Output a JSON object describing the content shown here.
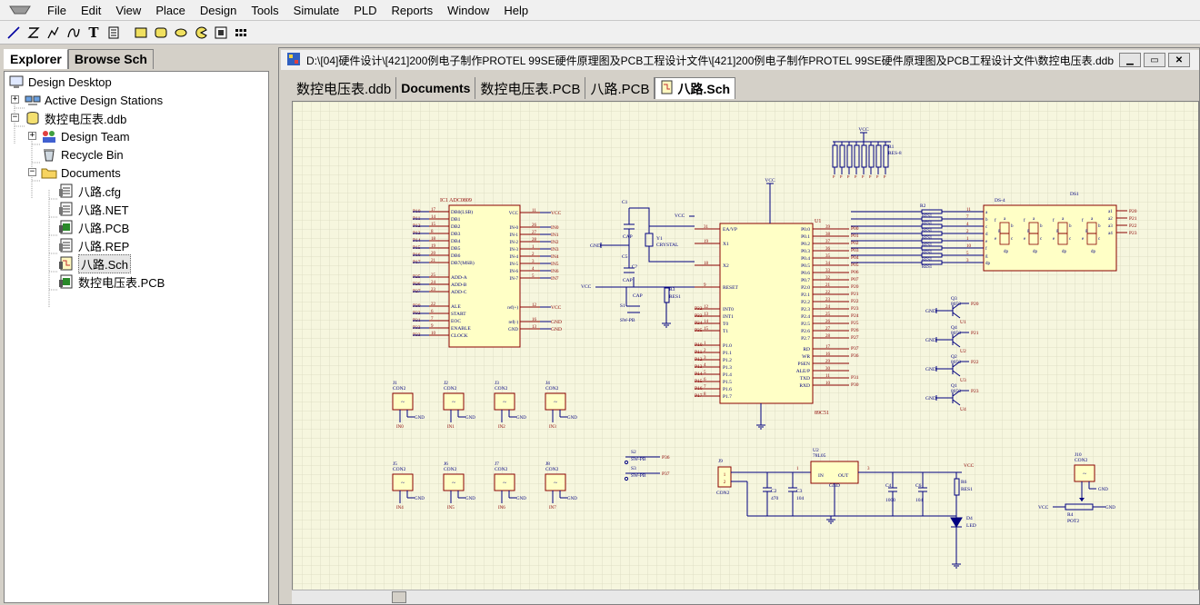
{
  "menu": {
    "items": [
      "File",
      "Edit",
      "View",
      "Place",
      "Design",
      "Tools",
      "Simulate",
      "PLD",
      "Reports",
      "Window",
      "Help"
    ]
  },
  "toolbar": {
    "tools": [
      "line-icon",
      "bus-icon",
      "pen-icon",
      "bezier-icon",
      "text-icon",
      "text-frame-icon",
      "rectangle-icon",
      "rounded-rectangle-icon",
      "ellipse-icon",
      "pie-icon",
      "graphic-icon",
      "array-icon"
    ]
  },
  "explorer": {
    "tabs": [
      "Explorer",
      "Browse Sch"
    ],
    "tree": {
      "root": "Design Desktop",
      "active_stations": "Active Design Stations",
      "ddb": "数控电压表.ddb",
      "design_team": "Design Team",
      "recycle_bin": "Recycle Bin",
      "documents": "Documents",
      "files": [
        "八路.cfg",
        "八路.NET",
        "八路.PCB",
        "八路.REP",
        "八路.Sch",
        "数控电压表.PCB"
      ],
      "selected": "八路.Sch"
    }
  },
  "document": {
    "title": "D:\\[04]硬件设计\\[421]200例电子制作PROTEL 99SE硬件原理图及PCB工程设计文件\\[421]200例电子制作PROTEL 99SE硬件原理图及PCB工程设计文件\\数控电压表.ddb",
    "tabs": [
      "数控电压表.ddb",
      "Documents",
      "数控电压表.PCB",
      "八路.PCB",
      "八路.Sch"
    ],
    "active_tab": "八路.Sch"
  },
  "schematic": {
    "colors": {
      "sheet": "#f6f6de",
      "grid": "#d9d9bf",
      "wire": "#000080",
      "body": "#ffffc6",
      "outline": "#8b0000",
      "pin": "#8b0000",
      "label": "#000080"
    },
    "adc": {
      "ref": "IC1",
      "part": "ADC0809",
      "left_pins": [
        [
          "17",
          "DB0(LSB)"
        ],
        [
          "14",
          "DB1"
        ],
        [
          "15",
          "DB2"
        ],
        [
          "8",
          "DB3"
        ],
        [
          "18",
          "DB4"
        ],
        [
          "19",
          "DB5"
        ],
        [
          "20",
          "DB6"
        ],
        [
          "21",
          "DB7(MSB)"
        ],
        [
          "",
          ""
        ],
        [
          "25",
          "ADD-A"
        ],
        [
          "24",
          "ADD-B"
        ],
        [
          "23",
          "ADD-C"
        ],
        [
          "",
          ""
        ],
        [
          "22",
          "ALE"
        ],
        [
          "6",
          "START"
        ],
        [
          "7",
          "EOC"
        ],
        [
          "9",
          "ENABLE"
        ],
        [
          "10",
          "CLOCK"
        ]
      ],
      "left_nets": [
        "P10",
        "P11",
        "P12",
        "P13",
        "P14",
        "P15",
        "P16",
        "P17",
        "",
        "P25",
        "P26",
        "P27",
        "",
        "P30",
        "P32",
        "P31",
        "P33",
        "P33"
      ],
      "right_pins": [
        [
          "11",
          "VCC"
        ],
        [
          "",
          ""
        ],
        [
          "26",
          "IN-0"
        ],
        [
          "27",
          "IN-1"
        ],
        [
          "28",
          "IN-2"
        ],
        [
          "1",
          "IN-3"
        ],
        [
          "2",
          "IN-4"
        ],
        [
          "3",
          "IN-5"
        ],
        [
          "4",
          "IN-6"
        ],
        [
          "5",
          "IN-7"
        ],
        [
          "",
          ""
        ],
        [
          "",
          ""
        ],
        [
          "",
          ""
        ],
        [
          "12",
          "ref(+)"
        ],
        [
          "",
          ""
        ],
        [
          "16",
          "ref(-)"
        ],
        [
          "13",
          "GND"
        ]
      ],
      "right_nets": [
        "VCC",
        "",
        "IN0",
        "IN1",
        "IN2",
        "IN3",
        "IN4",
        "IN5",
        "IN6",
        "IN7",
        "",
        "",
        "",
        "VCC",
        "",
        "GND",
        "GND"
      ]
    },
    "mcu": {
      "ref": "U1",
      "part": "89C51",
      "left_pins": [
        [
          "31",
          "EA/VP"
        ],
        [
          "19",
          "X1"
        ],
        [
          "18",
          "X2"
        ],
        [
          "9",
          "RESET"
        ],
        [
          "12",
          "INT0"
        ],
        [
          "13",
          "INT1"
        ],
        [
          "14",
          "T0"
        ],
        [
          "15",
          "T1"
        ],
        [
          "1",
          "P1.0"
        ],
        [
          "2",
          "P1.1"
        ],
        [
          "3",
          "P1.2"
        ],
        [
          "4",
          "P1.3"
        ],
        [
          "5",
          "P1.4"
        ],
        [
          "6",
          "P1.5"
        ],
        [
          "7",
          "P1.6"
        ],
        [
          "8",
          "P1.7"
        ]
      ],
      "right_pins": [
        [
          "39",
          "P0.0"
        ],
        [
          "38",
          "P0.1"
        ],
        [
          "37",
          "P0.2"
        ],
        [
          "36",
          "P0.3"
        ],
        [
          "35",
          "P0.4"
        ],
        [
          "34",
          "P0.5"
        ],
        [
          "33",
          "P0.6"
        ],
        [
          "32",
          "P0.7"
        ],
        [
          "21",
          "P2.0"
        ],
        [
          "22",
          "P2.1"
        ],
        [
          "23",
          "P2.2"
        ],
        [
          "24",
          "P2.3"
        ],
        [
          "25",
          "P2.4"
        ],
        [
          "26",
          "P2.5"
        ],
        [
          "27",
          "P2.6"
        ],
        [
          "28",
          "P2.7"
        ],
        [
          "17",
          "RD"
        ],
        [
          "16",
          "WR"
        ],
        [
          "29",
          "PSEN"
        ],
        [
          "30",
          "ALE/P"
        ],
        [
          "11",
          "TXD"
        ],
        [
          "10",
          "RXD"
        ]
      ],
      "right_nets": [
        "P00",
        "P01",
        "P02",
        "P03",
        "P04",
        "P05",
        "P06",
        "P07",
        "P20",
        "P21",
        "P22",
        "P23",
        "P24",
        "P25",
        "P26",
        "P27",
        "P37",
        "P36",
        "",
        "",
        "P31",
        "P30"
      ],
      "left_nets": [
        "",
        "",
        "",
        "",
        "P32",
        "P33",
        "P34",
        "P35",
        "P10",
        "P11",
        "P12",
        "P13",
        "P14",
        "P15",
        "P16",
        "P17"
      ]
    },
    "display": {
      "ref": "DS1",
      "part": "DS-4",
      "segments": [
        "a",
        "b",
        "c",
        "d",
        "e",
        "f",
        "g",
        "dp"
      ],
      "commons": [
        "a1",
        "a2",
        "a3",
        "a4"
      ],
      "nets": [
        "P20",
        "P21",
        "P22",
        "P23"
      ]
    },
    "resistor_array": {
      "ref": "R1",
      "part": "RES-8",
      "net": "VCC"
    },
    "segment_resistors": {
      "ref": "R2",
      "part": "RES1",
      "pins": [
        "11",
        "7",
        "4",
        "2",
        "1",
        "10",
        "5",
        "3"
      ]
    },
    "transistors": [
      {
        "ref": "Q3",
        "part": "8050",
        "net": "P20",
        "base": "U1"
      },
      {
        "ref": "Q4",
        "part": "8050",
        "net": "P21",
        "base": "U2"
      },
      {
        "ref": "Q2",
        "part": "8050",
        "net": "P22",
        "base": "U3"
      },
      {
        "ref": "Q1",
        "part": "8050",
        "net": "P23",
        "base": "U4"
      }
    ],
    "osc": {
      "c1": "C1",
      "c1_val": "CAP",
      "c2": "C5",
      "c2_val": "CAP",
      "xtal": "Y1",
      "xtal_val": "CRYSTAL",
      "c3": "C?",
      "c3_val": "CAP",
      "reset_sw": "S1",
      "reset_sw_val": "SW-PB",
      "reset_r": "R3",
      "reset_r_val": "RES1"
    },
    "connectors_top": [
      {
        "ref": "J1",
        "part": "CON2",
        "net": "IN0"
      },
      {
        "ref": "J2",
        "part": "CON2",
        "net": "IN1"
      },
      {
        "ref": "J3",
        "part": "CON2",
        "net": "IN2"
      },
      {
        "ref": "J4",
        "part": "CON2",
        "net": "IN3"
      }
    ],
    "connectors_bottom": [
      {
        "ref": "J5",
        "part": "CON2",
        "net": "IN4"
      },
      {
        "ref": "J6",
        "part": "CON2",
        "net": "IN5"
      },
      {
        "ref": "J7",
        "part": "CON2",
        "net": "IN6"
      },
      {
        "ref": "J8",
        "part": "CON2",
        "net": "IN7"
      }
    ],
    "buttons": [
      {
        "ref": "S2",
        "part": "SW-PB",
        "net": "P36"
      },
      {
        "ref": "S3",
        "part": "SW-PB",
        "net": "P37"
      }
    ],
    "power": {
      "j9": "J9",
      "j9_part": "CON2",
      "c2": "C2",
      "c2_val": "470",
      "c3": "C3",
      "c3_val": "104",
      "reg": "U2",
      "reg_part": "78L05",
      "reg_in": "IN",
      "reg_out": "OUT",
      "reg_gnd": "GND",
      "c4": "C4",
      "c4_val": "1000",
      "c6": "C6",
      "c6_val": "104",
      "r6": "R6",
      "r6_val": "RES1",
      "led": "D4",
      "led_val": "LED",
      "pins": [
        "1",
        "2",
        "1",
        "3"
      ]
    },
    "pot": {
      "ref": "J10",
      "part": "CON2",
      "r": "R4",
      "r_val": "POT2",
      "net": "VCC"
    },
    "nets": {
      "vcc": "VCC",
      "gnd": "GND"
    }
  }
}
